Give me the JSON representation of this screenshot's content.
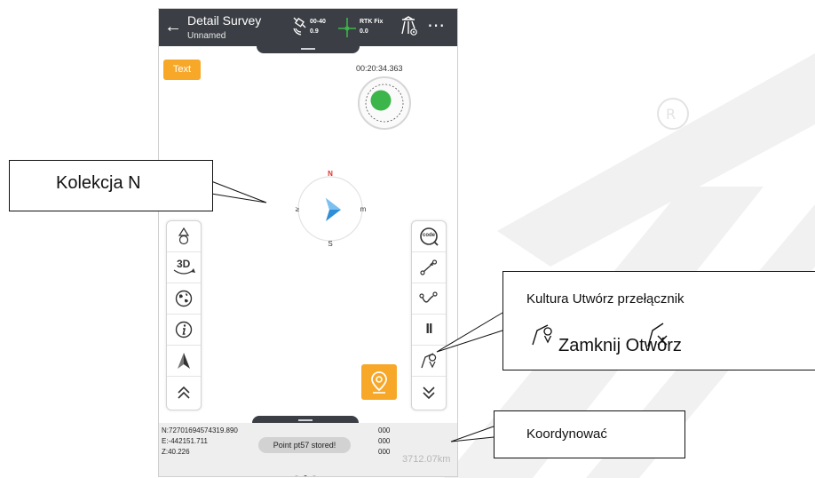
{
  "topbar": {
    "back_icon": "arrow-left-icon",
    "title": "Detail Survey",
    "subtitle": "Unnamed",
    "satellite_top": "00-40",
    "satellite_bottom": "0.9",
    "rtk_top": "RTK Fix",
    "rtk_bottom": "0.0",
    "more_label": "⋯"
  },
  "map": {
    "text_button": "Text",
    "timer": "00:20:34.363",
    "compass": {
      "n": "N",
      "s": "S",
      "e": "m",
      "w": "≥"
    }
  },
  "left_toolbar": {
    "view_3d_label": "3D"
  },
  "right_toolbar": {
    "code_label": "code",
    "pause_label": "II"
  },
  "coordinates": {
    "n": "N:72701694574319.890",
    "e": "E:-442151.711",
    "z": "Z:40.226",
    "right_values": [
      "000",
      "000",
      "000"
    ],
    "toast": "Point pt57 stored!",
    "distance": "3712.07km",
    "page_count": 3,
    "active_page": 2
  },
  "callouts": {
    "compass_label": "Kolekcja N",
    "feature_line1": "Kultura Utwórz przełącznik",
    "feature_line2": "Zamknij Otwórz",
    "coordinates_label": "Koordynować"
  },
  "colors": {
    "topbar": "#3b3f45",
    "accent_orange": "#f7a829",
    "fix_green": "#3cb54a",
    "compass_north": "#e0322b",
    "arrow_blue": "#2e8fd8"
  }
}
